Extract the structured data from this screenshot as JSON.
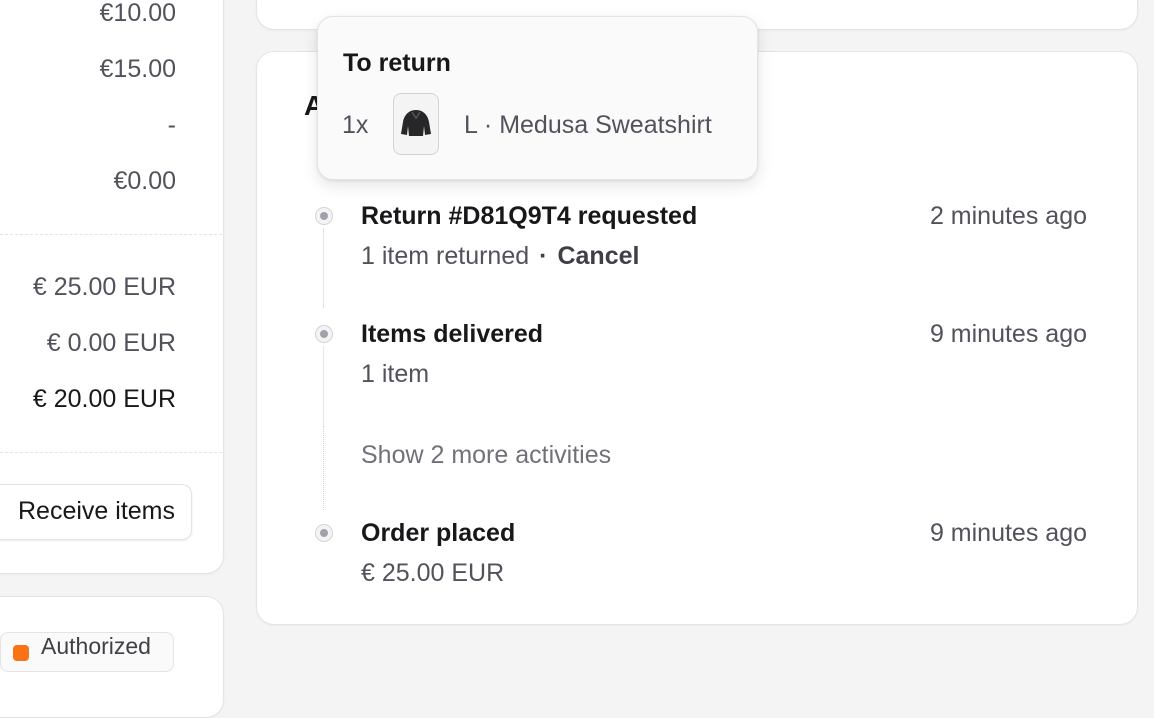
{
  "summary": {
    "rows": [
      "€10.00",
      "€15.00",
      "-",
      "€0.00"
    ],
    "totals": [
      "€ 25.00 EUR",
      "€ 0.00 EUR",
      "€ 20.00 EUR"
    ],
    "receive_button": "Receive items",
    "payment_status": "Authorized",
    "status_color": "#f97316"
  },
  "activity": {
    "heading": "A",
    "events": [
      {
        "title": "Return #D81Q9T4 requested",
        "sub": "1 item returned",
        "action": "Cancel",
        "time": "2 minutes ago"
      },
      {
        "title": "Items delivered",
        "sub": "1 item",
        "time": "9 minutes ago"
      },
      {
        "title": "Order placed",
        "sub": "€ 25.00 EUR",
        "time": "9 minutes ago"
      }
    ],
    "show_more": "Show 2 more activities"
  },
  "popover": {
    "title": "To return",
    "quantity": "1x",
    "thumbnail_icon": "sweatshirt-icon",
    "item_name": "L · Medusa Sweatshirt"
  }
}
